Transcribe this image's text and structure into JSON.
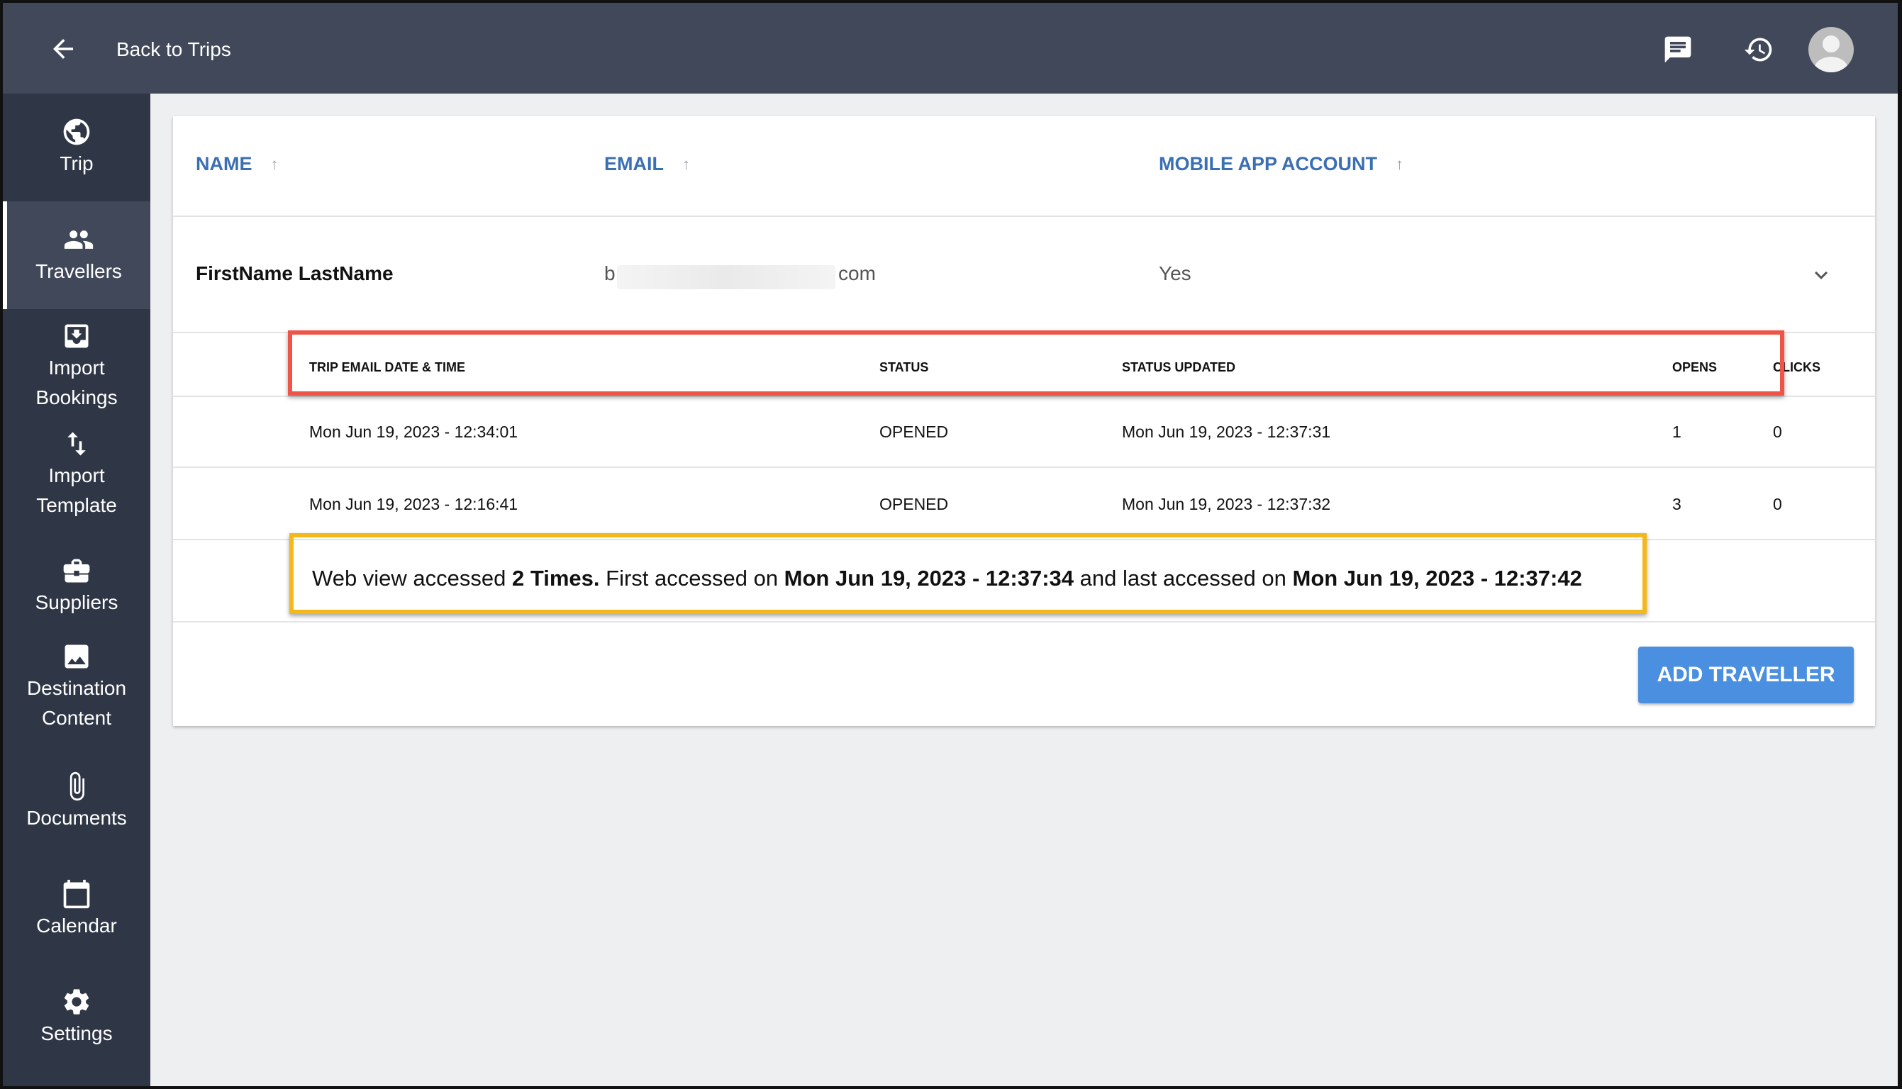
{
  "header": {
    "back_label": "Back to Trips"
  },
  "sidebar": {
    "items": [
      {
        "label": "Trip",
        "icon": "globe-icon"
      },
      {
        "label": "Travellers",
        "icon": "people-icon",
        "active": true
      },
      {
        "label": "Import\nBookings",
        "icon": "import-icon"
      },
      {
        "label": "Import\nTemplate",
        "icon": "swap-vertical-icon"
      },
      {
        "label": "Suppliers",
        "icon": "briefcase-icon"
      },
      {
        "label": "Destination\nContent",
        "icon": "image-icon"
      },
      {
        "label": "Documents",
        "icon": "paperclip-icon"
      },
      {
        "label": "Calendar",
        "icon": "calendar-icon"
      },
      {
        "label": "Settings",
        "icon": "gear-icon"
      }
    ]
  },
  "table": {
    "columns": [
      {
        "label": "NAME",
        "sort": "↑"
      },
      {
        "label": "EMAIL",
        "sort": "↑"
      },
      {
        "label": "MOBILE APP ACCOUNT",
        "sort": "↑"
      }
    ],
    "row": {
      "name": "FirstName LastName",
      "email_start": "b",
      "email_end": "com",
      "mobile": "Yes"
    }
  },
  "emails": {
    "headers": [
      "TRIP EMAIL DATE & TIME",
      "STATUS",
      "STATUS UPDATED",
      "OPENS",
      "CLICKS"
    ],
    "rows": [
      {
        "date": "Mon Jun 19, 2023 - 12:34:01",
        "status": "OPENED",
        "updated": "Mon Jun 19, 2023 - 12:37:31",
        "opens": "1",
        "clicks": "0"
      },
      {
        "date": "Mon Jun 19, 2023 - 12:16:41",
        "status": "OPENED",
        "updated": "Mon Jun 19, 2023 - 12:37:32",
        "opens": "3",
        "clicks": "0"
      }
    ]
  },
  "webview": {
    "prefix": "Web view accessed ",
    "count": "2 Times.",
    "first_label": " First accessed on ",
    "first": "Mon Jun 19, 2023 - 12:37:34",
    "last_label": " and last accessed on ",
    "last": "Mon Jun 19, 2023 - 12:37:42"
  },
  "actions": {
    "add_traveller": "ADD TRAVELLER"
  },
  "colors": {
    "topbar": "#404859",
    "sidebar": "#2f3646",
    "accent": "#3b6fb3",
    "button": "#4a8fe0",
    "highlight_red": "#ee5548",
    "highlight_yellow": "#f2b81c"
  }
}
